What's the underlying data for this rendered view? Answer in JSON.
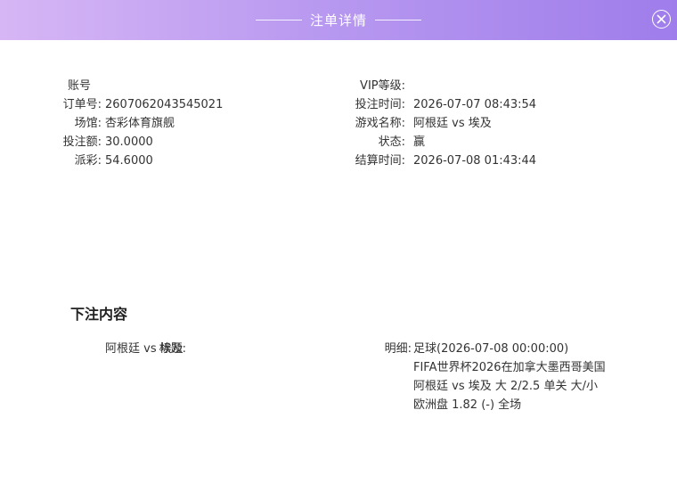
{
  "dialog": {
    "title": "注单详情"
  },
  "info_left": [
    {
      "label": "账号",
      "value": ""
    },
    {
      "label": "订单号:",
      "value": "2607062043545021"
    },
    {
      "label": "场馆:",
      "value": "杏彩体育旗舰"
    },
    {
      "label": "投注额:",
      "value": "30.0000"
    },
    {
      "label": "派彩:",
      "value": "54.6000"
    }
  ],
  "info_right": [
    {
      "label": "VIP等级:",
      "value": ""
    },
    {
      "label": "投注时间:",
      "value": "2026-07-07 08:43:54"
    },
    {
      "label": "游戏名称:",
      "value": "阿根廷 vs 埃及"
    },
    {
      "label": "状态:",
      "value": "赢"
    },
    {
      "label": "结算时间:",
      "value": "2026-07-08 01:43:44"
    }
  ],
  "bet_content": {
    "section_title": "下注内容",
    "title_label": "标题:",
    "title_value": "阿根廷 vs 埃及",
    "detail_label": "明细:",
    "detail_lines": [
      "足球(2026-07-08 00:00:00)",
      "FIFA世界杯2026在加拿大墨西哥美国",
      "阿根廷 vs 埃及 大 2/2.5 单关 大/小",
      "欧洲盘 1.82 (-) 全场"
    ]
  },
  "colors": {
    "header_start": "#d7b6f5",
    "header_end": "#9f7deb"
  }
}
